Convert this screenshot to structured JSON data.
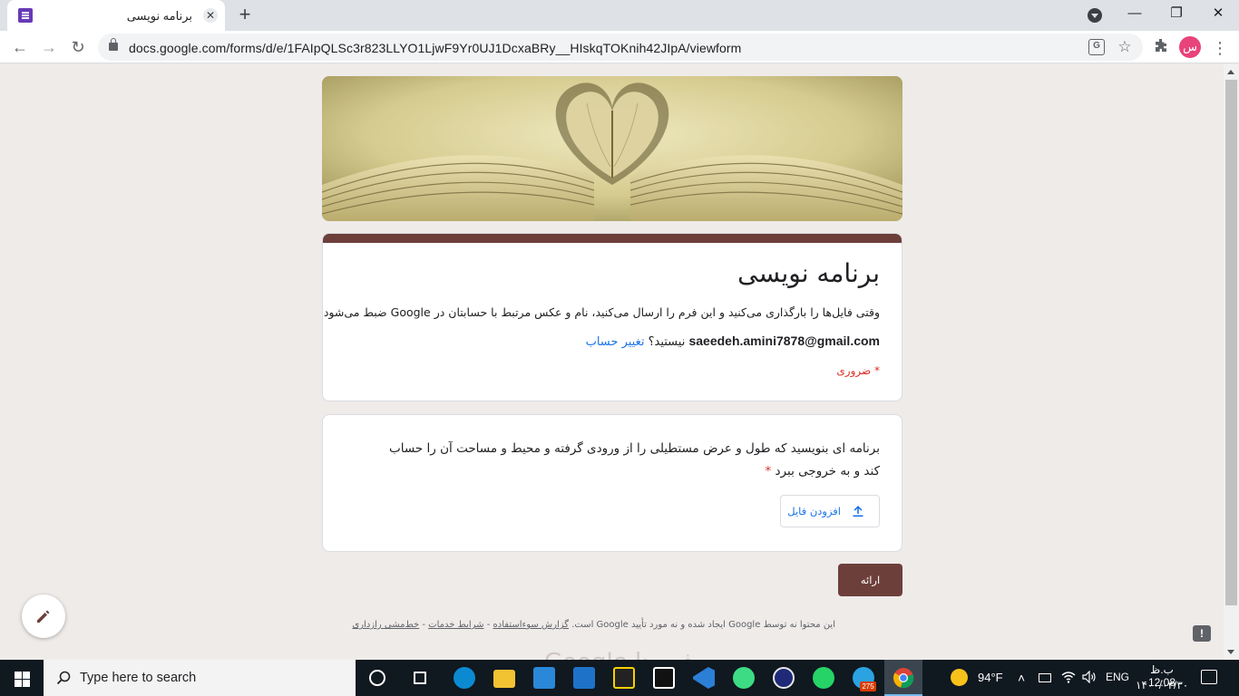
{
  "browser": {
    "tab_title": "برنامه نویسی",
    "tab_close": "✕",
    "new_tab": "+",
    "url": "docs.google.com/forms/d/e/1FAIpQLSc3r823LLYO1LjwF9Yr0UJ1DcxaBRy__HIskqTOKnih42JIpA/viewform",
    "profile_initial": "س",
    "window_minimize": "—",
    "window_restore": "❐",
    "window_close": "✕",
    "back": "←",
    "forward": "→",
    "reload": "↻",
    "star": "☆",
    "menu": "⋮",
    "translate": "G"
  },
  "form": {
    "title": "برنامه نویسی",
    "description": "وقتی فایل‌ها را بارگذاری می‌کنید و این فرم را ارسال می‌کنید، نام و عکس مرتبط با حسابتان در Google ضبط می‌شود",
    "account_email": "saeedeh.amini7878@gmail.com",
    "account_suffix": " نیستید؟ ",
    "switch_account": "تغییر حساب",
    "required_note": "* ضروری",
    "accent_color": "#6d3f3b",
    "question": {
      "text": "برنامه ای بنویسید که طول و عرض مستطیلی را از ورودی گرفته و محیط و مساحت آن را حساب کند و به خروجی ببرد",
      "required_star": " *",
      "upload_label": "افزودن فایل",
      "upload_icon": "upload-icon"
    },
    "submit_label": "ارائه",
    "footer": {
      "text": "این محتوا نه توسط Google ایجاد شده و نه مورد تأیید Google است. ",
      "report_abuse": "گزارش سوءاستفاده",
      "separator": " - ",
      "terms": "شرایط خدمات",
      "privacy": "خط‌مشی رازداری"
    },
    "footer_logo": "Google فرم‌ها",
    "report_icon": "!"
  },
  "taskbar": {
    "search_placeholder": "Type here to search",
    "telegram_badge": "275",
    "temperature": "94°F",
    "language": "ENG",
    "time": "ب.ظ 12:08",
    "date": "۱۴۰۰/۰۳/۳۰"
  }
}
